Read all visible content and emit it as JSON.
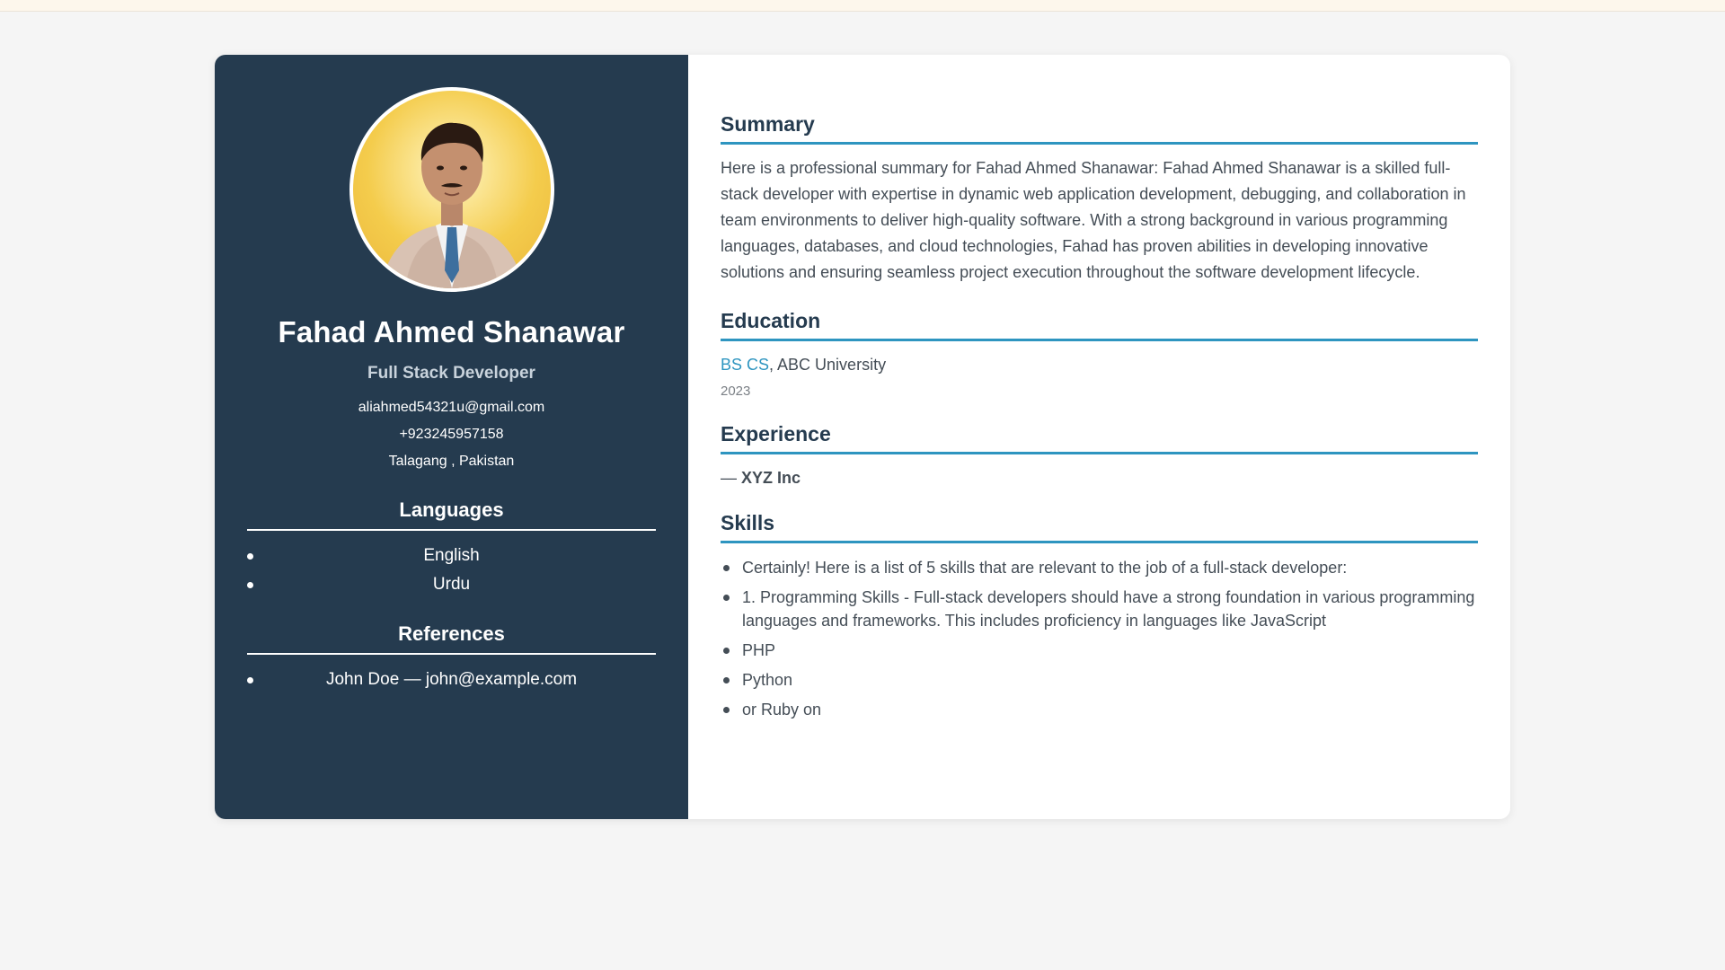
{
  "profile": {
    "name": "Fahad Ahmed Shanawar",
    "title": "Full Stack Developer",
    "email": "aliahmed54321u@gmail.com",
    "phone": "+923245957158",
    "location": "Talagang , Pakistan"
  },
  "languages": {
    "heading": "Languages",
    "items": [
      "English",
      "Urdu"
    ]
  },
  "references": {
    "heading": "References",
    "items": [
      "John Doe — john@example.com"
    ]
  },
  "summary": {
    "heading": "Summary",
    "text": "Here is a professional summary for Fahad Ahmed Shanawar: Fahad Ahmed Shanawar is a skilled full-stack developer with expertise in dynamic web application development, debugging, and collaboration in team environments to deliver high-quality software. With a strong background in various programming languages, databases, and cloud technologies, Fahad has proven abilities in developing innovative solutions and ensuring seamless project execution throughout the software development lifecycle."
  },
  "education": {
    "heading": "Education",
    "degree": "BS CS",
    "institution": ", ABC University",
    "year": "2023"
  },
  "experience": {
    "heading": "Experience",
    "dash": "— ",
    "company": "XYZ Inc"
  },
  "skills": {
    "heading": "Skills",
    "items": [
      "Certainly! Here is a list of 5 skills that are relevant to the job of a full-stack developer:",
      "1. Programming Skills - Full-stack developers should have a strong foundation in various programming languages and frameworks. This includes proficiency in languages like JavaScript",
      "PHP",
      "Python",
      "or Ruby on"
    ]
  },
  "colors": {
    "sidebar": "#253b4f",
    "accent": "#2e95c0",
    "background": "#f5f5f5"
  },
  "icons": {
    "avatar": "profile-photo"
  }
}
